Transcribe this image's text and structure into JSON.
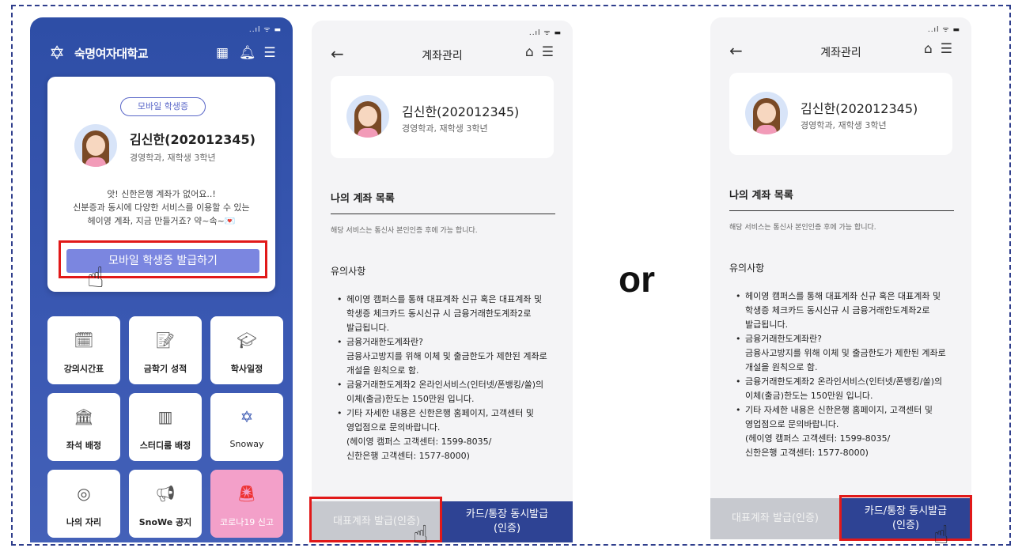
{
  "or_label": "or",
  "status_icons": "..ıl ᯤ ▬",
  "phone1": {
    "university_name": "숙명여자대학교",
    "head_icons": [
      "qr-icon",
      "bell-icon",
      "menu-icon"
    ],
    "badge": "모바일 학생증",
    "student_name": "김신한(202012345)",
    "student_info": "경영학과, 재학생 3학년",
    "message_lines": [
      "앗! 신한은행 계좌가 없어요..!",
      "신분증과 동시에 다양한 서비스를 이용할 수 있는",
      "헤이영 계좌, 지금 만들거죠? 약~속~💌"
    ],
    "issue_button": "모바일 학생증 발급하기",
    "menu": [
      {
        "label": "강의시간표",
        "icon": "timetable-icon"
      },
      {
        "label": "금학기 성적",
        "icon": "grade-icon"
      },
      {
        "label": "학사일정",
        "icon": "graduation-cap-icon"
      },
      {
        "label": "좌석 배정",
        "icon": "building-icon"
      },
      {
        "label": "스터디룸 배정",
        "icon": "studyroom-icon"
      },
      {
        "label": "Snoway",
        "icon": "snowflake-icon"
      },
      {
        "label": "나의 자리",
        "icon": "target-icon"
      },
      {
        "label": "SnoWe 공지",
        "icon": "megaphone-icon"
      },
      {
        "label": "코로나19 신고",
        "icon": "siren-icon"
      }
    ]
  },
  "account": {
    "title": "계좌관리",
    "student_name": "김신한(202012345)",
    "student_info": "경영학과, 재학생 3학년",
    "section_title": "나의 계좌 목록",
    "section_note": "해당 서비스는 통신사 본인인증 후에 가능 합니다.",
    "notice_title": "유의사항",
    "notices": [
      {
        "lines": [
          "헤이영 캠퍼스를 통해 대표계좌 신규 혹은 대표계좌 및",
          "학생증 체크카드 동시신규 시 금융거래한도계좌2로",
          "발급됩니다."
        ]
      },
      {
        "lines": [
          "금융거래한도계좌란?",
          "금융사고방지를 위해 이체 및 출금한도가 제한된 계좌로",
          "개설을 원칙으로 함."
        ]
      },
      {
        "lines": [
          "금융거래한도계좌2 온라인서비스(인터넷/폰뱅킹/쏠)의",
          "이체(출금)한도는 150만원 입니다."
        ]
      },
      {
        "lines": [
          "기타 자세한 내용은 신한은행 홈페이지, 고객센터 및",
          "영업점으로 문의바랍니다.",
          "(헤이영 캠퍼스 고객센터: 1599-8035/",
          "신한은행 고객센터: 1577-8000)"
        ]
      }
    ],
    "btn_primary_account": "대표계좌 발급(인증)",
    "btn_card_line1": "카드/통장 동시발급",
    "btn_card_line2": "(인증)"
  }
}
